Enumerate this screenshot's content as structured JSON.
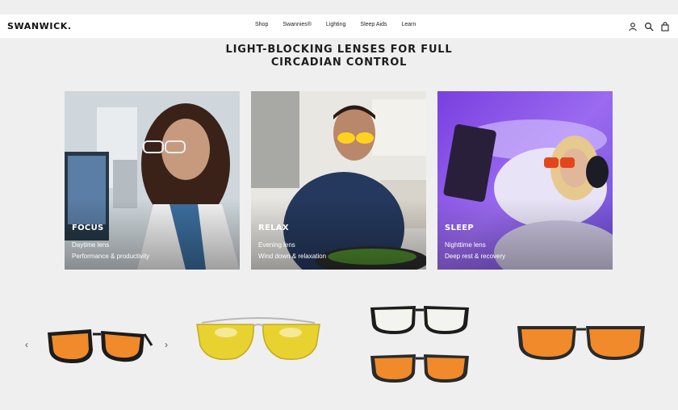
{
  "brand": "SWANWICK.",
  "nav": [
    "Shop",
    "Swannies®",
    "Lighting",
    "Sleep Aids",
    "Learn"
  ],
  "icons": {
    "account": "account-icon",
    "search": "search-icon",
    "cart": "cart-icon"
  },
  "headline_line1": "LIGHT-BLOCKING LENSES FOR FULL",
  "headline_line2": "CIRCADIAN CONTROL",
  "cards": [
    {
      "title": "FOCUS",
      "line1": "Daytime lens",
      "line2": "Performance & productivity"
    },
    {
      "title": "RELAX",
      "line1": "Evening lens",
      "line2": "Wind down & relaxation"
    },
    {
      "title": "SLEEP",
      "line1": "Nighttime lens",
      "line2": "Deep rest & recovery"
    }
  ],
  "carousel": {
    "prev": "‹",
    "next": "›"
  },
  "colors": {
    "amber_lens": "#f08a2a",
    "yellow_lens": "#e8d230",
    "clear_lens": "#f4f4ee",
    "frame": "#1b1b1b"
  }
}
